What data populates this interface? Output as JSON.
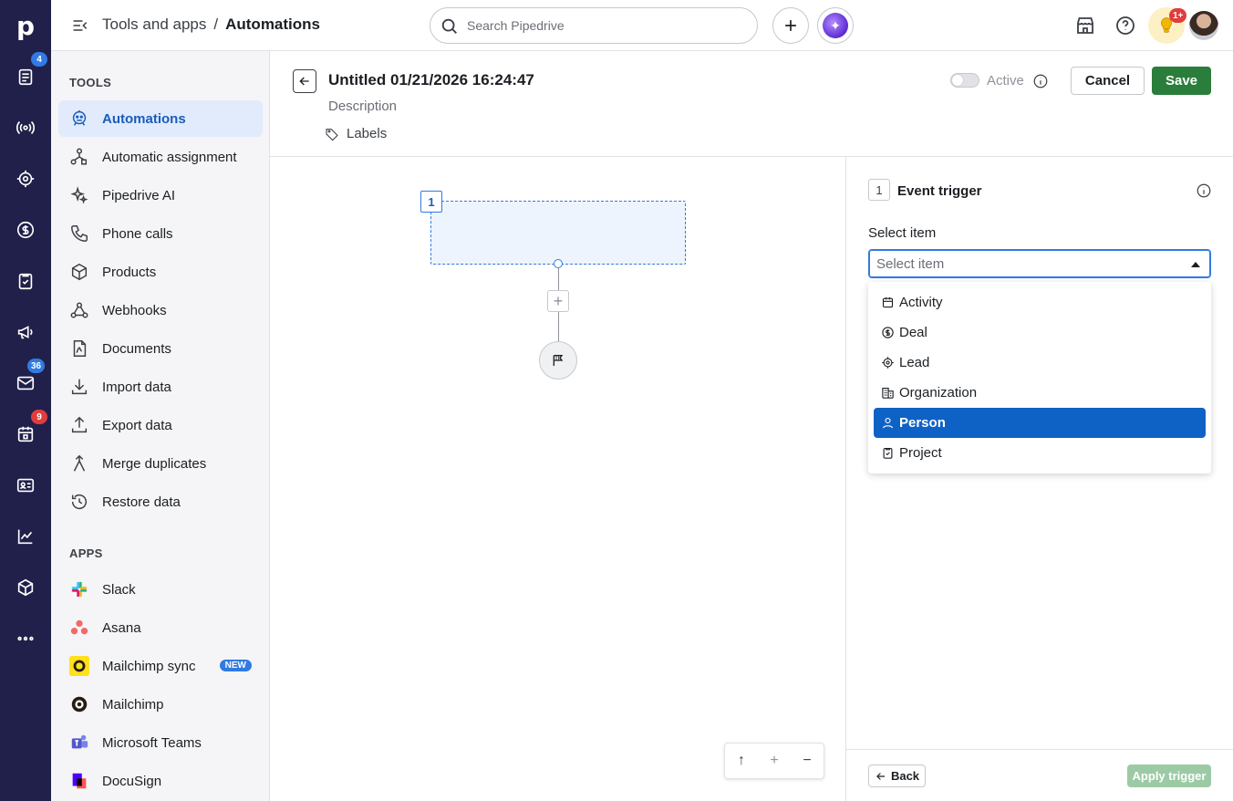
{
  "rail": {
    "logo": "p",
    "badges": {
      "deals": "4",
      "mail": "36",
      "calendar": "9"
    }
  },
  "topbar": {
    "breadcrumb_parent": "Tools and apps",
    "breadcrumb_sep": "/",
    "breadcrumb_current": "Automations",
    "search_placeholder": "Search Pipedrive",
    "notif_badge": "1+"
  },
  "sidebar": {
    "tools_title": "TOOLS",
    "tools": [
      {
        "label": "Automations",
        "icon": "automation-bot-icon"
      },
      {
        "label": "Automatic assignment",
        "icon": "assignment-icon"
      },
      {
        "label": "Pipedrive AI",
        "icon": "sparkle-icon"
      },
      {
        "label": "Phone calls",
        "icon": "phone-icon"
      },
      {
        "label": "Products",
        "icon": "box-icon"
      },
      {
        "label": "Webhooks",
        "icon": "webhook-icon"
      },
      {
        "label": "Documents",
        "icon": "document-icon"
      },
      {
        "label": "Import data",
        "icon": "download-icon"
      },
      {
        "label": "Export data",
        "icon": "upload-icon"
      },
      {
        "label": "Merge duplicates",
        "icon": "merge-icon"
      },
      {
        "label": "Restore data",
        "icon": "restore-icon"
      }
    ],
    "apps_title": "APPS",
    "apps": [
      {
        "label": "Slack"
      },
      {
        "label": "Asana"
      },
      {
        "label": "Mailchimp sync",
        "badge": "NEW"
      },
      {
        "label": "Mailchimp"
      },
      {
        "label": "Microsoft Teams"
      },
      {
        "label": "DocuSign"
      }
    ]
  },
  "editor": {
    "title": "Untitled 01/21/2026 16:24:47",
    "description": "Description",
    "labels": "Labels",
    "active_label": "Active",
    "cancel": "Cancel",
    "save": "Save"
  },
  "canvas": {
    "node_number": "1",
    "add_symbol": "+",
    "zoom": {
      "up": "↑",
      "in": "+",
      "out": "−"
    }
  },
  "panel": {
    "step_number": "1",
    "title": "Event trigger",
    "select_label": "Select item",
    "select_placeholder": "Select item",
    "options": [
      {
        "label": "Activity",
        "icon": "calendar-icon"
      },
      {
        "label": "Deal",
        "icon": "dollar-icon"
      },
      {
        "label": "Lead",
        "icon": "target-icon"
      },
      {
        "label": "Organization",
        "icon": "building-icon"
      },
      {
        "label": "Person",
        "icon": "person-icon"
      },
      {
        "label": "Project",
        "icon": "clipboard-icon"
      }
    ],
    "highlighted_option": "Person",
    "back": "Back",
    "apply": "Apply trigger"
  }
}
